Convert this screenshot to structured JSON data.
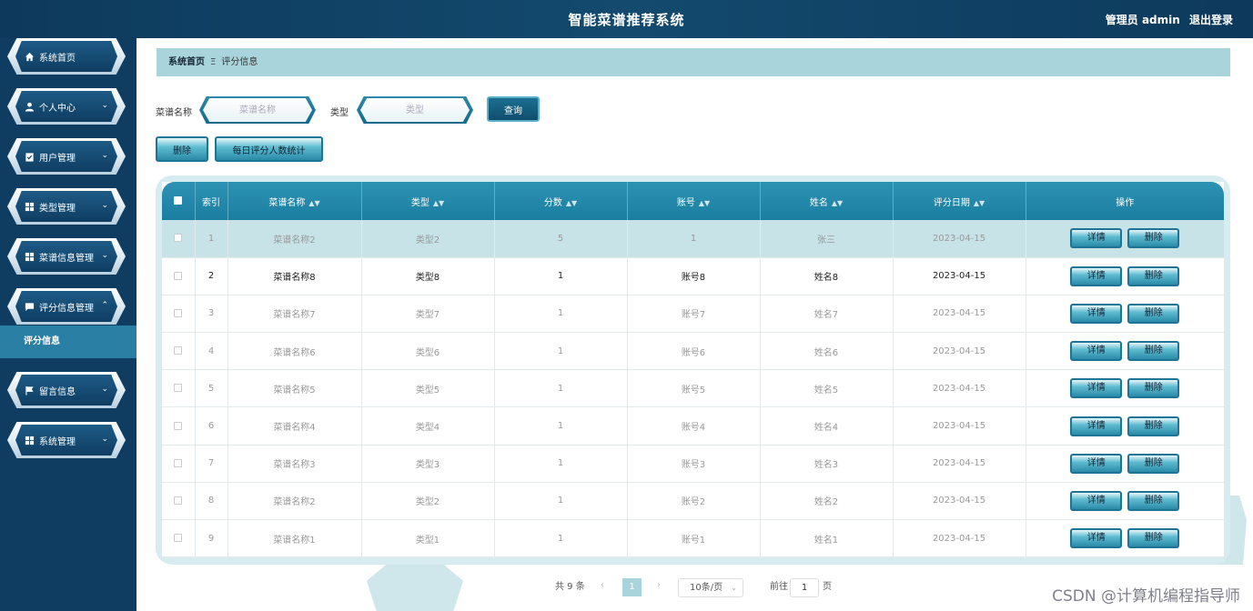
{
  "header": {
    "title": "智能菜谱推荐系统",
    "user_label": "管理员 admin",
    "logout": "退出登录"
  },
  "sidebar": {
    "items": [
      {
        "label": "系统首页",
        "icon": "home-icon",
        "expandable": false
      },
      {
        "label": "个人中心",
        "icon": "user-icon",
        "expandable": true
      },
      {
        "label": "用户管理",
        "icon": "clipboard-icon",
        "expandable": true
      },
      {
        "label": "类型管理",
        "icon": "grid-icon",
        "expandable": true
      },
      {
        "label": "菜谱信息管理",
        "icon": "grid-icon",
        "expandable": true
      },
      {
        "label": "评分信息管理",
        "icon": "comment-icon",
        "expandable": true,
        "expanded": true
      },
      {
        "label": "留言信息",
        "icon": "flag-icon",
        "expandable": true
      },
      {
        "label": "系统管理",
        "icon": "grid-icon",
        "expandable": true
      }
    ],
    "sub_active": "评分信息"
  },
  "breadcrumb": {
    "home": "系统首页",
    "separator": "Ξ",
    "current": "评分信息"
  },
  "search": {
    "name_label": "菜谱名称",
    "name_placeholder": "菜谱名称",
    "type_label": "类型",
    "type_placeholder": "类型",
    "query_button": "查询"
  },
  "actions": {
    "delete_button": "删除",
    "stats_button": "每日评分人数统计"
  },
  "table": {
    "columns": [
      "索引",
      "菜谱名称",
      "类型",
      "分数",
      "账号",
      "姓名",
      "评分日期",
      "操作"
    ],
    "rows": [
      {
        "index": "1",
        "name": "菜谱名称2",
        "type": "类型2",
        "score": "5",
        "account": "1",
        "person": "张三",
        "date": "2023-04-15"
      },
      {
        "index": "2",
        "name": "菜谱名称8",
        "type": "类型8",
        "score": "1",
        "account": "账号8",
        "person": "姓名8",
        "date": "2023-04-15"
      },
      {
        "index": "3",
        "name": "菜谱名称7",
        "type": "类型7",
        "score": "1",
        "account": "账号7",
        "person": "姓名7",
        "date": "2023-04-15"
      },
      {
        "index": "4",
        "name": "菜谱名称6",
        "type": "类型6",
        "score": "1",
        "account": "账号6",
        "person": "姓名6",
        "date": "2023-04-15"
      },
      {
        "index": "5",
        "name": "菜谱名称5",
        "type": "类型5",
        "score": "1",
        "account": "账号5",
        "person": "姓名5",
        "date": "2023-04-15"
      },
      {
        "index": "6",
        "name": "菜谱名称4",
        "type": "类型4",
        "score": "1",
        "account": "账号4",
        "person": "姓名4",
        "date": "2023-04-15"
      },
      {
        "index": "7",
        "name": "菜谱名称3",
        "type": "类型3",
        "score": "1",
        "account": "账号3",
        "person": "姓名3",
        "date": "2023-04-15"
      },
      {
        "index": "8",
        "name": "菜谱名称2",
        "type": "类型2",
        "score": "1",
        "account": "账号2",
        "person": "姓名2",
        "date": "2023-04-15"
      },
      {
        "index": "9",
        "name": "菜谱名称1",
        "type": "类型1",
        "score": "1",
        "account": "账号1",
        "person": "姓名1",
        "date": "2023-04-15"
      }
    ],
    "detail_button": "详情",
    "delete_button": "删除"
  },
  "pagination": {
    "total": "共 9 条",
    "current_page": "1",
    "page_size": "10条/页",
    "goto_label": "前往",
    "goto_value": "1",
    "page_unit": "页"
  },
  "watermark": "CSDN @计算机编程指导师",
  "colors": {
    "header_bg": "#0d3a5c",
    "sidebar_bg": "#0f3d62",
    "accent": "#1a7ea0",
    "breadcrumb_bg": "#aad4dc"
  }
}
